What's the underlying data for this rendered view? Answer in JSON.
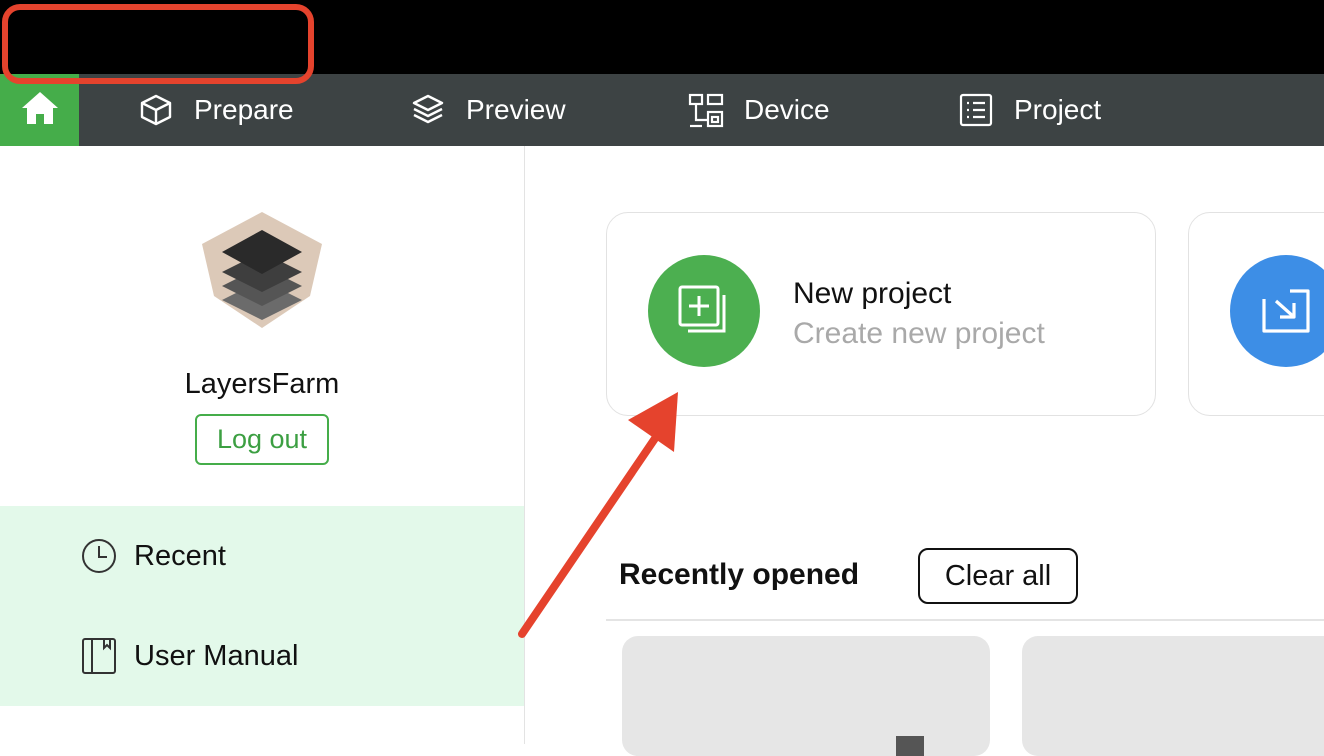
{
  "nav": {
    "home_icon": "home-icon",
    "items": [
      {
        "label": "Prepare",
        "icon": "cube-icon"
      },
      {
        "label": "Preview",
        "icon": "layers-icon"
      },
      {
        "label": "Device",
        "icon": "device-icon"
      },
      {
        "label": "Project",
        "icon": "list-icon"
      }
    ],
    "colors": {
      "bar": "#3d4344",
      "active": "#45ad4a"
    }
  },
  "sidebar": {
    "username": "LayersFarm",
    "logout_label": "Log out",
    "menu": [
      {
        "label": "Recent",
        "icon": "clock-icon"
      },
      {
        "label": "User Manual",
        "icon": "book-icon"
      }
    ],
    "menu_bg": "#e3f9ea"
  },
  "main": {
    "cards": [
      {
        "title": "New project",
        "subtitle": "Create new project",
        "icon": "new-project-icon",
        "color": "#4caf50"
      },
      {
        "icon": "import-icon",
        "color": "#3d8ee6"
      }
    ],
    "recent_title": "Recently opened",
    "clear_label": "Clear all"
  },
  "annotation": {
    "color": "#e5432d"
  }
}
